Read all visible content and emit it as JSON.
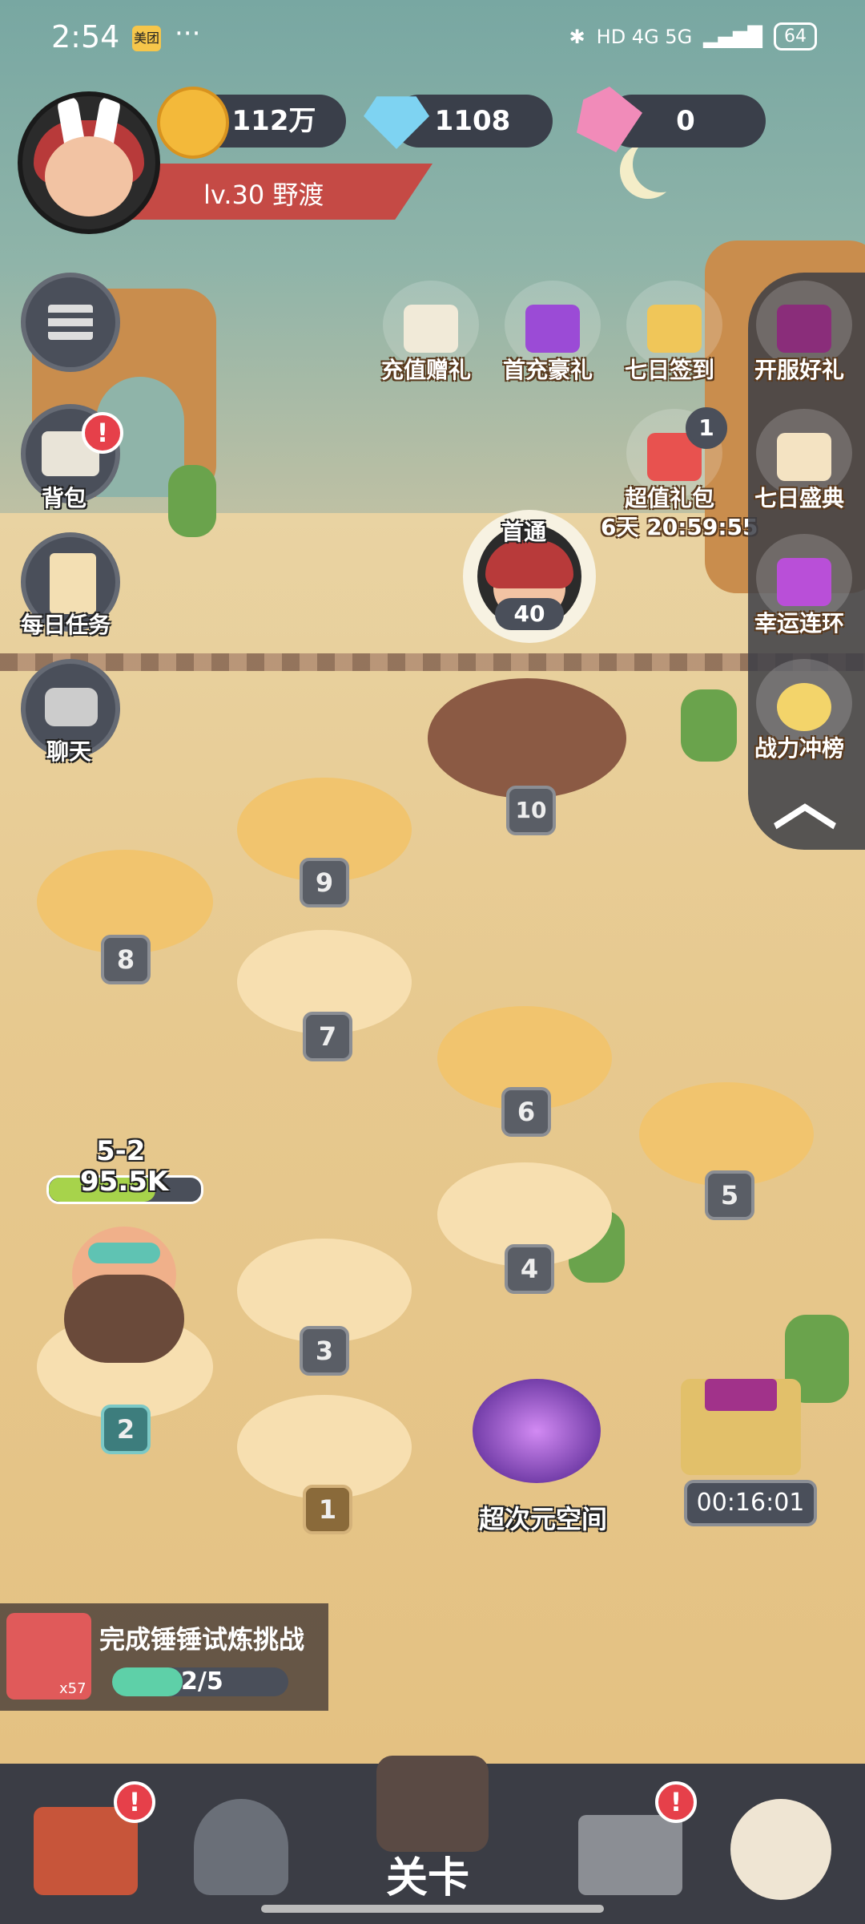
{
  "status_bar": {
    "time": "2:54",
    "app_badge": "美团",
    "dots": "···",
    "network": "HD 4G 5G",
    "battery": "64"
  },
  "player": {
    "level_name": "lv.30  野渡"
  },
  "resources": {
    "gold": "112万",
    "diamond": "1108",
    "crystal": "0"
  },
  "left_menu": {
    "bag": "背包",
    "daily": "每日任务",
    "chat": "聊天",
    "bag_badge": "!"
  },
  "events_top": [
    {
      "label": "充值赠礼"
    },
    {
      "label": "首充豪礼"
    },
    {
      "label": "七日签到"
    }
  ],
  "value_pack": {
    "label": "超值礼包",
    "timer": "6天 20:59:55",
    "badge": "1"
  },
  "right_panel": [
    {
      "label": "开服好礼"
    },
    {
      "label": "七日盛典"
    },
    {
      "label": "幸运连环"
    },
    {
      "label": "战力冲榜"
    }
  ],
  "boss": {
    "title": "首通",
    "level": "40"
  },
  "stages": [
    "1",
    "2",
    "3",
    "4",
    "5",
    "6",
    "7",
    "8",
    "9",
    "10"
  ],
  "hero": {
    "stage": "5-2",
    "power": "95.5K"
  },
  "portal": {
    "label": "超次元空间"
  },
  "chest": {
    "timer": "00:16:01"
  },
  "task": {
    "title": "完成锤锤试炼挑战",
    "count": "x57",
    "progress": "2/5",
    "progress_value": 0.4
  },
  "bottom_nav": {
    "center_label": "关卡",
    "badge": "!"
  },
  "colors": {
    "accent_red": "#e6404a",
    "panel_dark": "#3a3f4a",
    "progress_green": "#5ed0a8"
  }
}
